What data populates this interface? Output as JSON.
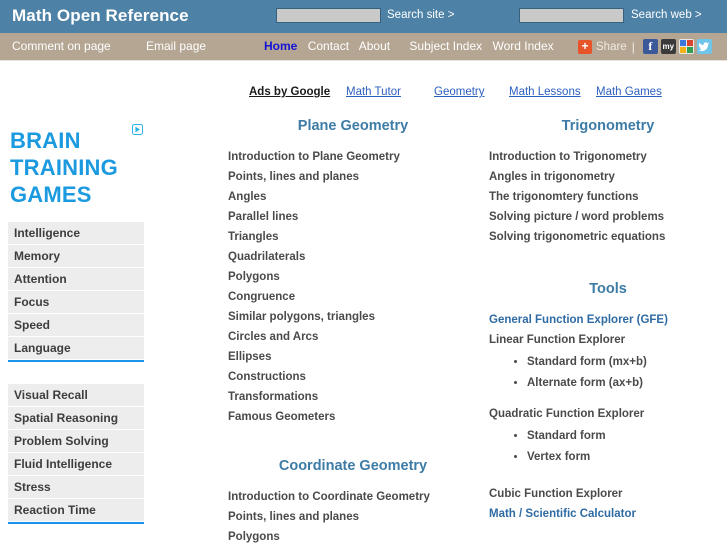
{
  "header": {
    "site_title": "Math Open Reference",
    "search_site": {
      "value": "",
      "placeholder": "",
      "label": "Search site >"
    },
    "search_web": {
      "value": "",
      "placeholder": "",
      "label": "Search web >"
    }
  },
  "nav": {
    "comment_on_page": "Comment on page",
    "email_page": "Email page",
    "items": [
      {
        "label": "Home",
        "active": true
      },
      {
        "label": "Contact",
        "active": false
      },
      {
        "label": "About",
        "active": false
      },
      {
        "label": "Subject Index",
        "active": false
      },
      {
        "label": "Word Index",
        "active": false
      }
    ],
    "share": {
      "plus": "+",
      "label": "Share",
      "separator": "|",
      "icons": [
        {
          "name": "facebook-icon",
          "glyph": "f"
        },
        {
          "name": "myspace-icon",
          "glyph": "my"
        },
        {
          "name": "google-icon",
          "glyph": ""
        },
        {
          "name": "twitter-icon",
          "glyph": "ᵦ"
        }
      ]
    }
  },
  "ads_strip": {
    "ads_by_google": "Ads by Google",
    "links": [
      "Math Tutor",
      "Geometry",
      "Math Lessons",
      "Math Games"
    ]
  },
  "sidebar_ad": {
    "adchoices_icon": "adchoices-icon",
    "headline_line1": "BRAIN",
    "headline_line2": "TRAINING",
    "headline_line3": "GAMES",
    "group1": [
      "Intelligence",
      "Memory",
      "Attention",
      "Focus",
      "Speed",
      "Language"
    ],
    "group2": [
      "Visual Recall",
      "Spatial Reasoning",
      "Problem Solving",
      "Fluid Intelligence",
      "Stress",
      "Reaction Time"
    ],
    "accent_color": "#1a94ea",
    "headline_color": "#1b9ae0"
  },
  "middle_column": {
    "plane_geometry": {
      "title": "Plane Geometry",
      "items": [
        "Introduction to Plane Geometry",
        "Points, lines and planes",
        "Angles",
        "Parallel lines",
        "Triangles",
        "Quadrilaterals",
        "Polygons",
        "Congruence",
        "Similar polygons, triangles",
        "Circles and Arcs",
        "Ellipses",
        "Constructions",
        "Transformations",
        "Famous Geometers"
      ]
    },
    "coordinate_geometry": {
      "title": "Coordinate Geometry",
      "items": [
        "Introduction to Coordinate Geometry",
        "Points, lines and planes",
        "Polygons"
      ]
    }
  },
  "right_column": {
    "trigonometry": {
      "title": "Trigonometry",
      "items": [
        "Introduction to Trigonometry",
        "Angles in trigonometry",
        "The trigonomtery functions",
        "Solving picture / word problems",
        "Solving trigonometric equations"
      ]
    },
    "tools": {
      "title": "Tools",
      "general_function_explorer": "General Function Explorer (GFE)",
      "linear_function_explorer": "Linear Function Explorer",
      "linear_forms": [
        "Standard form (mx+b)",
        "Alternate form (ax+b)"
      ],
      "quadratic_function_explorer": "Quadratic Function Explorer",
      "quadratic_forms": [
        "Standard form",
        "Vertex form"
      ],
      "cubic_function_explorer": "Cubic Function Explorer",
      "calculator": "Math / Scientific Calculator"
    }
  },
  "colors": {
    "topbar": "#4d82a6",
    "navbar": "#b5a693",
    "section_heading": "#3c7ca6",
    "link_blue": "#2b5fbe",
    "home_active": "#1414d6"
  }
}
